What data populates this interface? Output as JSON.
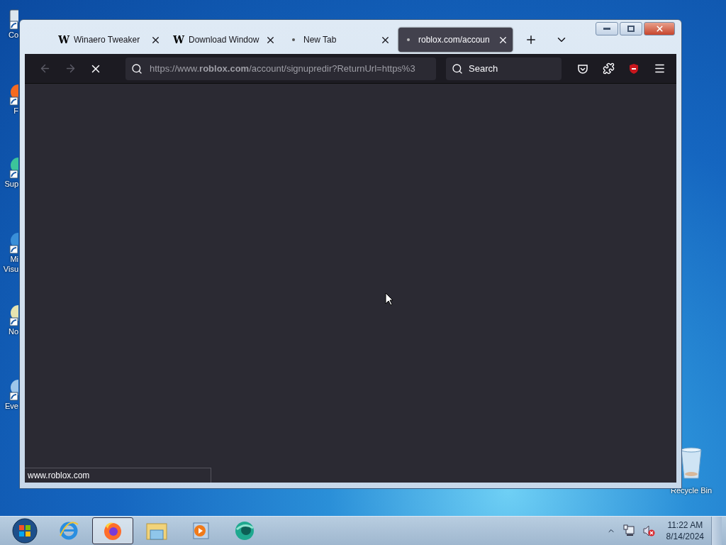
{
  "desktop_icons": [
    {
      "lines": [
        "Co"
      ],
      "kind": "computer"
    },
    {
      "lines": [
        "F"
      ],
      "kind": "shortcut-orange"
    },
    {
      "lines": [
        "Sup"
      ],
      "kind": "shortcut-green"
    },
    {
      "lines": [
        "Mi",
        "Visu"
      ],
      "kind": "shortcut-blue"
    },
    {
      "lines": [
        "No"
      ],
      "kind": "shortcut-note"
    },
    {
      "lines": [
        "Eve"
      ],
      "kind": "shortcut-plain"
    }
  ],
  "recycle_bin": {
    "label": "Recycle Bin"
  },
  "browser": {
    "tabs": [
      {
        "title": "Winaero Tweaker",
        "kind": "letter",
        "favicon_text": "W",
        "selected": false
      },
      {
        "title": "Download Window",
        "kind": "letter",
        "favicon_text": "W",
        "selected": false
      },
      {
        "title": "New Tab",
        "kind": "dot",
        "selected": false
      },
      {
        "title": "roblox.com/accoun",
        "kind": "dot",
        "selected": true
      }
    ],
    "url": "https://www.**roblox.com**/account/signupredir?ReturnUrl=https%3",
    "search": {
      "placeholder": "Search"
    },
    "loading": true,
    "status": "www.roblox.com"
  },
  "taskbar": {
    "items": [
      {
        "kind": "ie",
        "selected": false
      },
      {
        "kind": "firefox",
        "selected": true
      },
      {
        "kind": "explorer",
        "selected": false
      },
      {
        "kind": "media",
        "selected": false
      },
      {
        "kind": "app",
        "selected": false
      }
    ],
    "time": "11:22 AM",
    "date": "8/14/2024"
  }
}
